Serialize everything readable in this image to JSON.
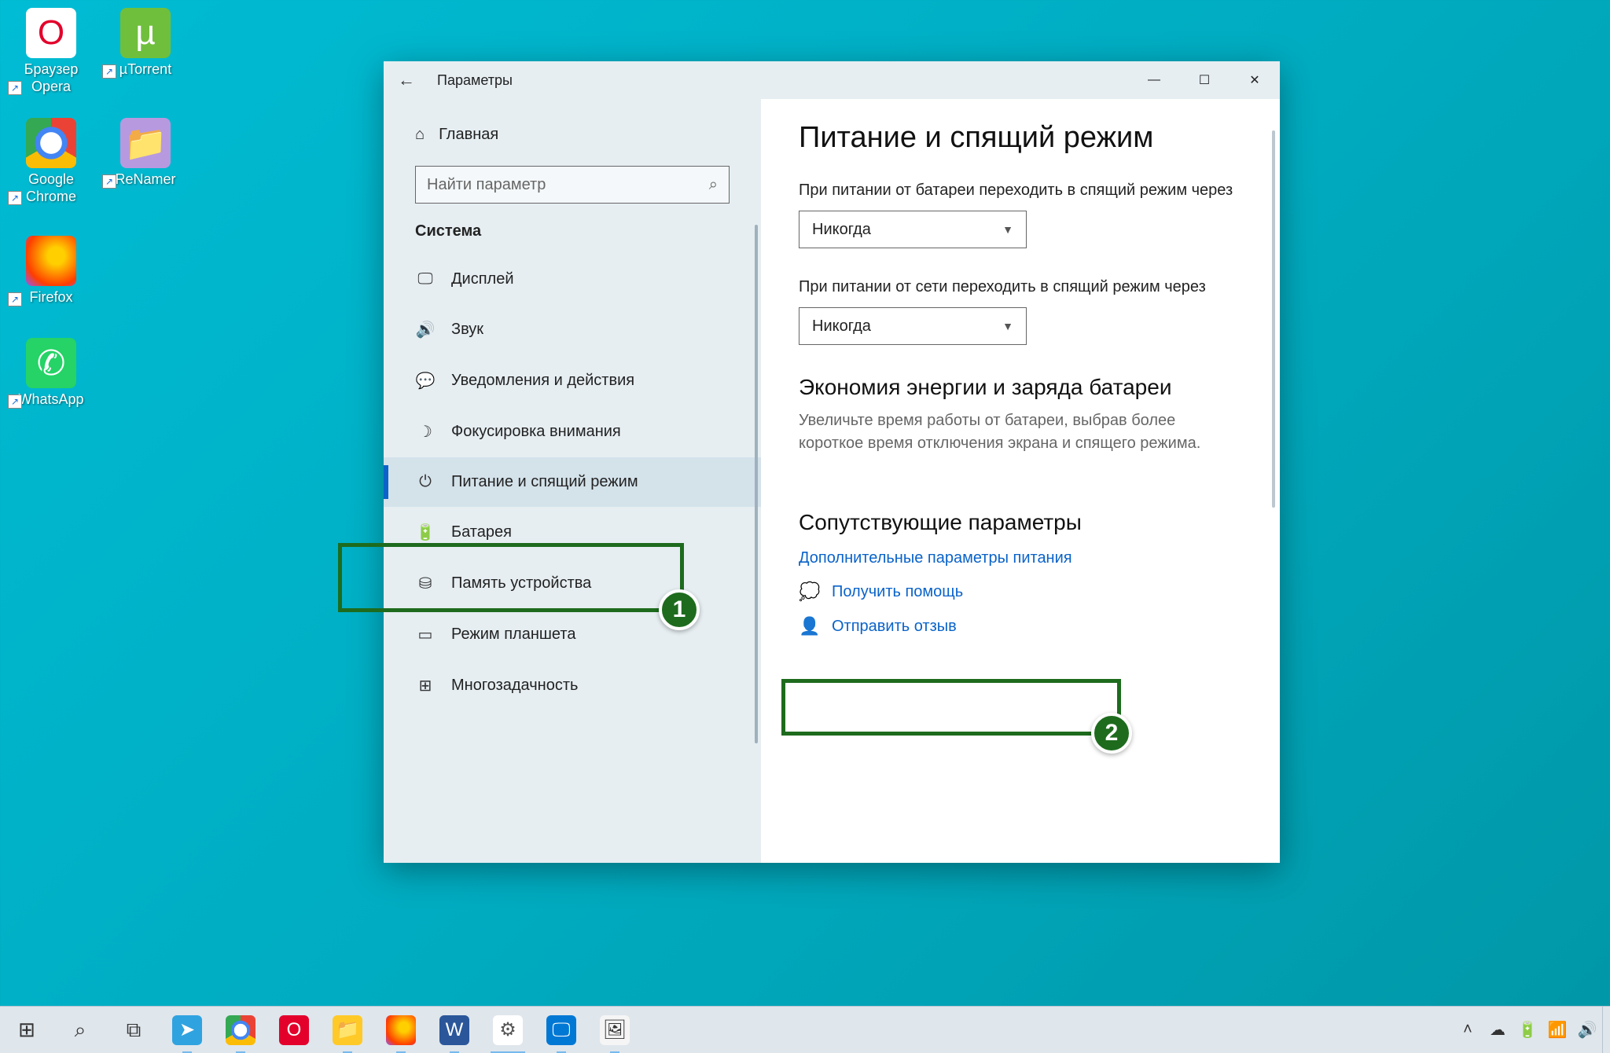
{
  "desktop_icons": [
    {
      "label": "Браузер\nOpera"
    },
    {
      "label": "µTorrent"
    },
    {
      "label": "Google\nChrome"
    },
    {
      "label": "ReNamer"
    },
    {
      "label": "Firefox"
    },
    {
      "label": "WhatsApp"
    }
  ],
  "window": {
    "title": "Параметры",
    "home": "Главная",
    "search_placeholder": "Найти параметр",
    "section": "Система",
    "nav": [
      {
        "icon": "display",
        "label": "Дисплей"
      },
      {
        "icon": "sound",
        "label": "Звук"
      },
      {
        "icon": "notify",
        "label": "Уведомления и действия"
      },
      {
        "icon": "focus",
        "label": "Фокусировка внимания"
      },
      {
        "icon": "power",
        "label": "Питание и спящий режим",
        "active": true
      },
      {
        "icon": "battery",
        "label": "Батарея"
      },
      {
        "icon": "storage",
        "label": "Память устройства"
      },
      {
        "icon": "tablet",
        "label": "Режим планшета"
      },
      {
        "icon": "multi",
        "label": "Многозадачность"
      }
    ]
  },
  "content": {
    "h1": "Питание и спящий режим",
    "battery_sleep_label": "При питании от батареи переходить в спящий режим через",
    "battery_sleep_value": "Никогда",
    "ac_sleep_label": "При питании от сети переходить в спящий режим через",
    "ac_sleep_value": "Никогда",
    "saver_h": "Экономия энергии и заряда батареи",
    "saver_desc": "Увеличьте время работы от батареи, выбрав более короткое время отключения экрана и спящего режима.",
    "related_h": "Сопутствующие параметры",
    "related_link": "Дополнительные параметры питания",
    "help_link": "Получить помощь",
    "feedback_link": "Отправить отзыв"
  },
  "annotations": {
    "a1": "1",
    "a2": "2"
  }
}
